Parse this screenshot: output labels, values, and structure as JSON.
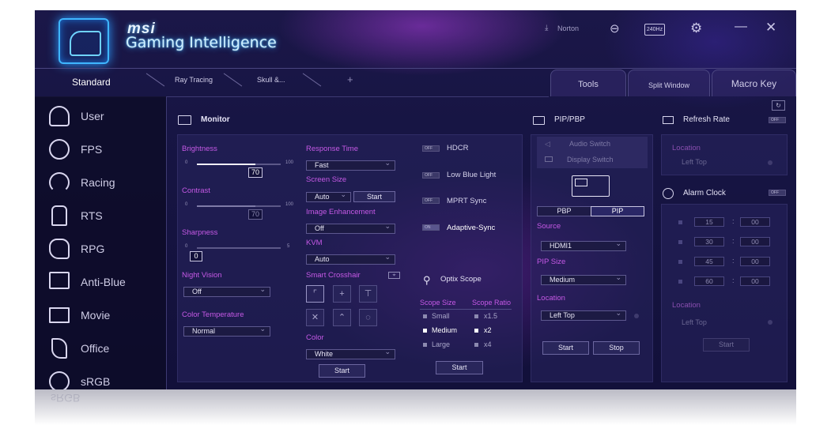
{
  "header": {
    "brand": "msi",
    "title": "Gaming Intelligence",
    "norton_label": "Norton",
    "refresh_badge": "240Hz"
  },
  "tabs": {
    "left": [
      "Standard",
      "Ray Tracing",
      "Skull &...",
      "+"
    ],
    "right": [
      "Tools",
      "Split Window",
      "Macro Key"
    ]
  },
  "sidebar": {
    "items": [
      {
        "label": "User",
        "icon": "user-icon"
      },
      {
        "label": "FPS",
        "icon": "crosshair-icon"
      },
      {
        "label": "Racing",
        "icon": "speedometer-icon"
      },
      {
        "label": "RTS",
        "icon": "chess-piece-icon"
      },
      {
        "label": "RPG",
        "icon": "helmet-icon"
      },
      {
        "label": "Anti-Blue",
        "icon": "book-icon"
      },
      {
        "label": "Movie",
        "icon": "film-icon"
      },
      {
        "label": "Office",
        "icon": "pen-icon"
      },
      {
        "label": "sRGB",
        "icon": "color-circles-icon"
      }
    ],
    "reflection_label": "sRGB"
  },
  "monitor": {
    "title": "Monitor",
    "brightness": {
      "label": "Brightness",
      "min": "0",
      "max": "100",
      "value": "70",
      "fraction": 0.7
    },
    "contrast": {
      "label": "Contrast",
      "min": "0",
      "max": "100",
      "value": "70",
      "fraction": 0.7
    },
    "sharpness": {
      "label": "Sharpness",
      "min": "0",
      "max": "5",
      "value": "0",
      "fraction": 0
    },
    "night_vision": {
      "label": "Night Vision",
      "value": "Off"
    },
    "color_temperature": {
      "label": "Color Temperature",
      "value": "Normal"
    },
    "response_time": {
      "label": "Response Time",
      "value": "Fast"
    },
    "screen_size": {
      "label": "Screen Size",
      "value": "Auto",
      "button": "Start"
    },
    "image_enhancement": {
      "label": "Image Enhancement",
      "value": "Off"
    },
    "kvm": {
      "label": "KVM",
      "value": "Auto"
    },
    "smart_crosshair": {
      "label": "Smart Crosshair",
      "color_label": "Color",
      "color_value": "White",
      "button": "Start"
    },
    "toggles": [
      {
        "label": "HDCR",
        "state": "OFF"
      },
      {
        "label": "Low Blue Light",
        "state": "OFF"
      },
      {
        "label": "MPRT Sync",
        "state": "OFF"
      },
      {
        "label": "Adaptive-Sync",
        "state": "ON"
      }
    ],
    "optix_scope": {
      "title": "Optix Scope",
      "size_label": "Scope Size",
      "ratio_label": "Scope Ratio",
      "sizes": [
        "Small",
        "Medium",
        "Large"
      ],
      "ratios": [
        "x1.5",
        "x2",
        "x4"
      ],
      "selected_size": "Medium",
      "selected_ratio": "x2",
      "button": "Start"
    }
  },
  "pip": {
    "title": "PIP/PBP",
    "audio_switch": "Audio Switch",
    "display_switch": "Display Switch",
    "modes": [
      "PBP",
      "PIP"
    ],
    "selected_mode": "PIP",
    "source_label": "Source",
    "source_value": "HDMI1",
    "size_label": "PIP Size",
    "size_value": "Medium",
    "location_label": "Location",
    "location_value": "Left Top",
    "start": "Start",
    "stop": "Stop"
  },
  "refresh_rate": {
    "title": "Refresh Rate",
    "toggle": "OFF",
    "location_label": "Location",
    "location_value": "Left Top"
  },
  "alarm_clock": {
    "title": "Alarm Clock",
    "toggle": "OFF",
    "rows": [
      {
        "minutes": "15",
        "seconds": "00"
      },
      {
        "minutes": "30",
        "seconds": "00"
      },
      {
        "minutes": "45",
        "seconds": "00"
      },
      {
        "minutes": "60",
        "seconds": "00"
      }
    ],
    "separator": ":",
    "location_label": "Location",
    "location_value": "Left Top",
    "button": "Start"
  },
  "colors": {
    "accent_magenta": "#c659e6",
    "logo_blue": "#3fb6ff",
    "background": "#171544"
  }
}
